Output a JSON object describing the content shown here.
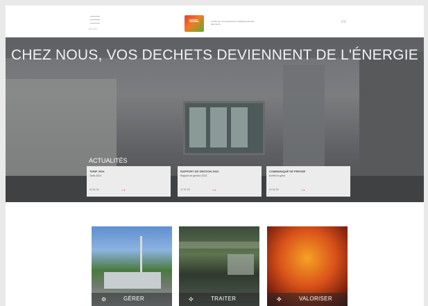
{
  "header": {
    "menu_label": "MENU",
    "logo_text": "SIDEL",
    "logo_caption": "USINE DE VALORISATION THERMIQUE DES DECHETS",
    "language": "DE"
  },
  "hero": {
    "title": "CHEZ NOUS, VOS DECHETS DEVIENNENT DE L'ÉNERGIE",
    "news_heading": "ACTUALITÉS",
    "news": [
      {
        "title": "TARIF 2024",
        "subtitle": "Tarifs 2024",
        "date": "01.01.24"
      },
      {
        "title": "RAPPORT DE GESTION 2022",
        "subtitle": "Rapport de gestion 2022",
        "date": "17.07.23"
      },
      {
        "title": "COMMUNIQUÉ DE PRESSE",
        "subtitle": "Arrêté en gène",
        "date": "01.02.23"
      }
    ]
  },
  "tiles": [
    {
      "label": "GÉRER",
      "icon": "gear-icon",
      "glyph": "⚙"
    },
    {
      "label": "TRAITER",
      "icon": "flow-icon",
      "glyph": "✣"
    },
    {
      "label": "VALORISER",
      "icon": "recycle-icon",
      "glyph": "✜"
    }
  ],
  "colors": {
    "accent": "#e5482b",
    "background": "#ffffff",
    "card": "#ececec"
  }
}
